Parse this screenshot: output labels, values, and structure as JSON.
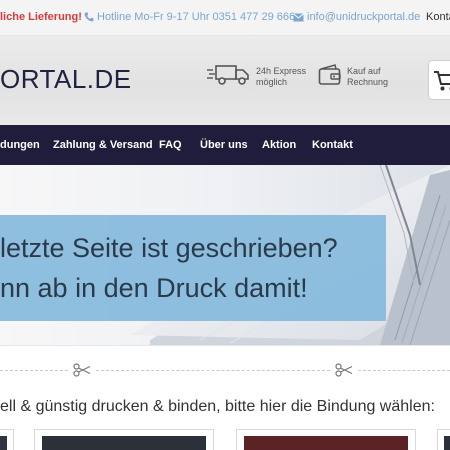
{
  "topbar": {
    "promo": "liche Lieferung!",
    "hotline": "Hotline Mo-Fr 9-17 Uhr 0351 477 29 666",
    "email": "info@unidruckportal.de",
    "contact": "Kontakt"
  },
  "header": {
    "logo": "ORTAL.DE",
    "features": [
      {
        "icon": "truck-icon",
        "line1": "24h Express",
        "line2": "möglich"
      },
      {
        "icon": "wallet-icon",
        "line1": "Kauf auf",
        "line2": "Rechnung"
      }
    ],
    "cart_icon": "cart-icon"
  },
  "nav": {
    "items": [
      "dungen",
      "Zahlung & Versand",
      "FAQ",
      "Über uns",
      "Aktion",
      "Kontakt"
    ]
  },
  "hero": {
    "line1": "letzte Seite ist geschrieben?",
    "line2": "nn ab in den Druck damit!"
  },
  "section": {
    "headline": "ell & günstig drucken & binden, bitte hier die Bindung wählen:"
  },
  "colors": {
    "nav_bg": "#1f1d3b",
    "banner": "#86badc",
    "promo": "#d63b3b",
    "link": "#7aa6cf"
  }
}
